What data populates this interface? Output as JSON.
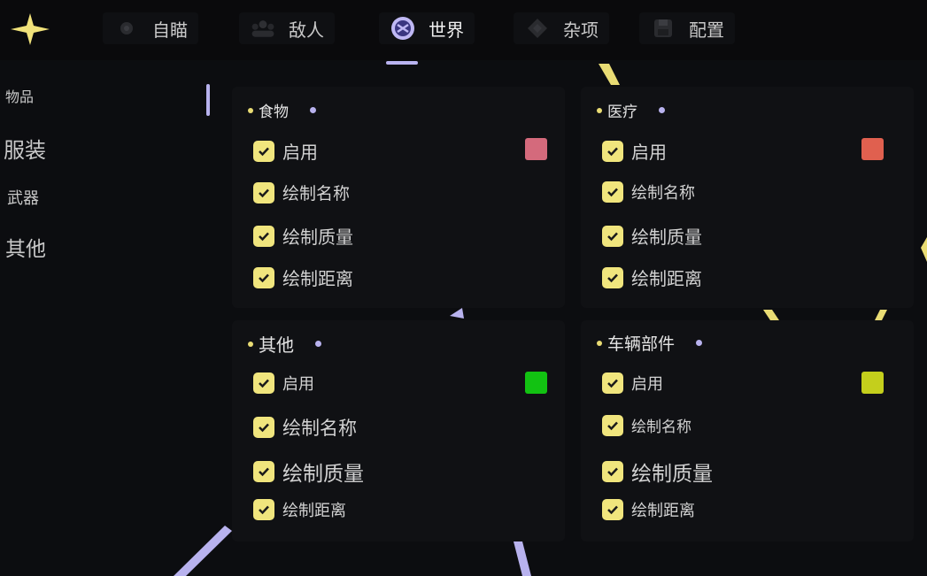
{
  "tabs": [
    {
      "label": "自瞄",
      "icon": "crosshair-icon"
    },
    {
      "label": "敌人",
      "icon": "enemy-group-icon"
    },
    {
      "label": "世界",
      "icon": "globe-icon",
      "active": true
    },
    {
      "label": "杂项",
      "icon": "cube-icon"
    },
    {
      "label": "配置",
      "icon": "save-icon"
    }
  ],
  "sidebar": {
    "items": [
      {
        "label": "物品",
        "active": true
      },
      {
        "label": "服装"
      },
      {
        "label": "武器"
      },
      {
        "label": "其他"
      }
    ]
  },
  "panels": [
    {
      "title": "食物",
      "enable_label": "启用",
      "options": [
        "绘制名称",
        "绘制质量",
        "绘制距离"
      ],
      "color": "#d46a7c"
    },
    {
      "title": "医疗",
      "enable_label": "启用",
      "options": [
        "绘制名称",
        "绘制质量",
        "绘制距离"
      ],
      "color": "#e0604f"
    },
    {
      "title": "其他",
      "enable_label": "启用",
      "options": [
        "绘制名称",
        "绘制质量",
        "绘制距离"
      ],
      "color": "#12c212"
    },
    {
      "title": "车辆部件",
      "enable_label": "启用",
      "options": [
        "绘制名称",
        "绘制质量",
        "绘制距离"
      ],
      "color": "#c4cf1c"
    }
  ],
  "colors": {
    "accent_yellow": "#f0e57d",
    "accent_purple": "#b8b2ee",
    "background": "#0c0d10",
    "panel": "#101114"
  }
}
